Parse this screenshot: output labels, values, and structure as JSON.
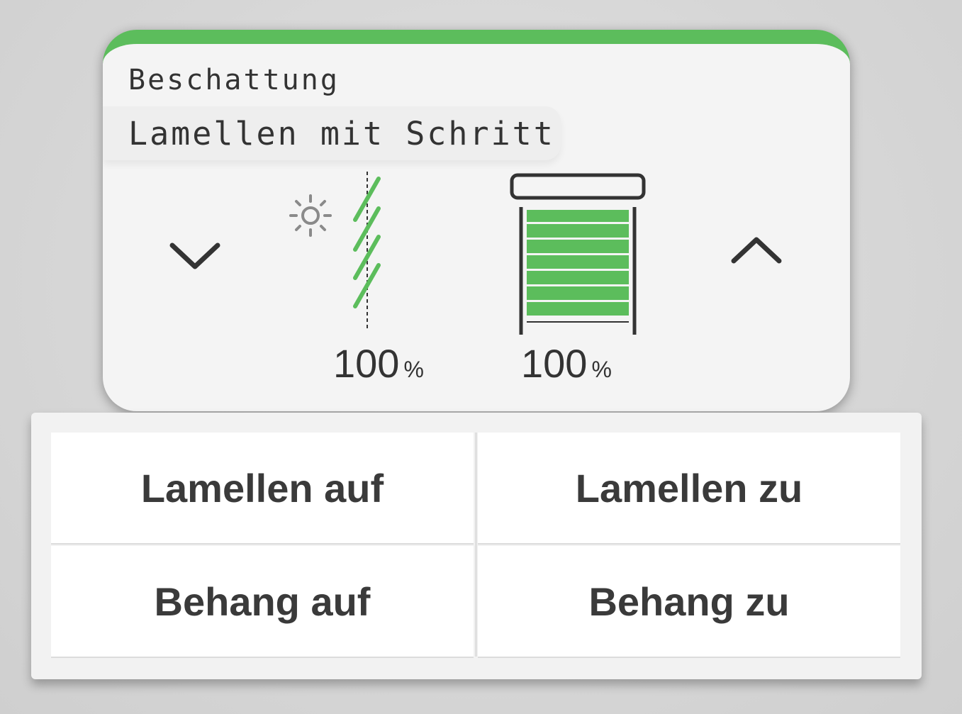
{
  "card": {
    "title": "Beschattung",
    "subtitle": "Lamellen mit Schritt",
    "accent_color": "#5cbd5c",
    "slat": {
      "value": "100",
      "unit": "%",
      "icon": "slat-angle-icon",
      "extra_icon": "sun-icon"
    },
    "shutter": {
      "value": "100",
      "unit": "%",
      "icon": "shutter-icon"
    },
    "down_icon": "chevron-down-icon",
    "up_icon": "chevron-up-icon"
  },
  "buttons": {
    "slats_open": "Lamellen auf",
    "slats_close": "Lamellen zu",
    "blind_open": "Behang auf",
    "blind_close": "Behang zu"
  }
}
